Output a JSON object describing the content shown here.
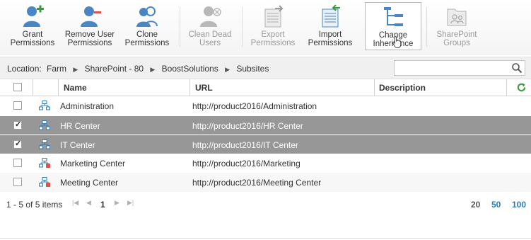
{
  "ribbon": {
    "buttons": [
      {
        "label_line1": "Grant",
        "label_line2": "Permissions",
        "icon": "grant-user-icon"
      },
      {
        "label_line1": "Remove User",
        "label_line2": "Permissions",
        "icon": "remove-user-icon"
      },
      {
        "label_line1": "Clone",
        "label_line2": "Permissions",
        "icon": "clone-user-icon"
      },
      {
        "label_line1": "Clean Dead",
        "label_line2": "Users",
        "icon": "clean-dead-users-icon"
      },
      {
        "label_line1": "Export",
        "label_line2": "Permissions",
        "icon": "export-icon"
      },
      {
        "label_line1": "Import",
        "label_line2": "Permissions",
        "icon": "import-icon"
      },
      {
        "label_line1": "Change",
        "label_line2": "Inheritance",
        "icon": "change-inheritance-icon"
      },
      {
        "label_line1": "SharePoint",
        "label_line2": "Groups",
        "icon": "sharepoint-groups-icon"
      }
    ]
  },
  "location": {
    "label": "Location:",
    "crumbs": [
      "Farm",
      "SharePoint - 80",
      "BoostSolutions",
      "Subsites"
    ],
    "separator": "▶"
  },
  "search": {
    "value": "",
    "placeholder": ""
  },
  "grid": {
    "columns": {
      "name": "Name",
      "url": "URL",
      "description": "Description"
    },
    "rows": [
      {
        "name": "Administration",
        "url": "http://product2016/Administration",
        "description": "",
        "checked": false,
        "selected": false
      },
      {
        "name": "HR Center",
        "url": "http://product2016/HR Center",
        "description": "",
        "checked": true,
        "selected": true
      },
      {
        "name": "IT Center",
        "url": "http://product2016/IT Center",
        "description": "",
        "checked": true,
        "selected": true
      },
      {
        "name": "Marketing Center",
        "url": "http://product2016/Marketing",
        "description": "",
        "checked": false,
        "selected": false
      },
      {
        "name": "Meeting Center",
        "url": "http://product2016/Meeting Center",
        "description": "",
        "checked": false,
        "selected": false
      }
    ]
  },
  "pager": {
    "info": "1 - 5 of 5 items",
    "current_page": "1",
    "sizes": [
      "20",
      "50",
      "100"
    ],
    "active_size": "20"
  },
  "colors": {
    "accent": "#2b7bbd",
    "selected_row": "#979797",
    "icon_green": "#3b9b3b",
    "icon_red": "#d9534f"
  }
}
